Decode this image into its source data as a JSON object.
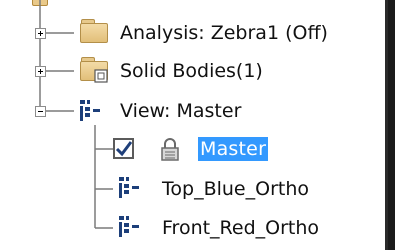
{
  "tree": {
    "items": [
      {
        "label": "Analysis: Zebra1 (Off)",
        "icon": "folder-icon",
        "expander": "plus"
      },
      {
        "label": "Solid Bodies(1)",
        "icon": "solid-bodies-folder-icon",
        "expander": "plus"
      },
      {
        "label": "View: Master",
        "icon": "view-icon",
        "expander": "minus"
      },
      {
        "label": "Master",
        "icon": "lock-icon",
        "checked": true,
        "selected": true
      },
      {
        "label": "Top_Blue_Ortho",
        "icon": "view-icon"
      },
      {
        "label": "Front_Red_Ortho",
        "icon": "view-icon"
      }
    ]
  },
  "colors": {
    "selection": "#3399ff",
    "folder": "#e9c98a"
  }
}
